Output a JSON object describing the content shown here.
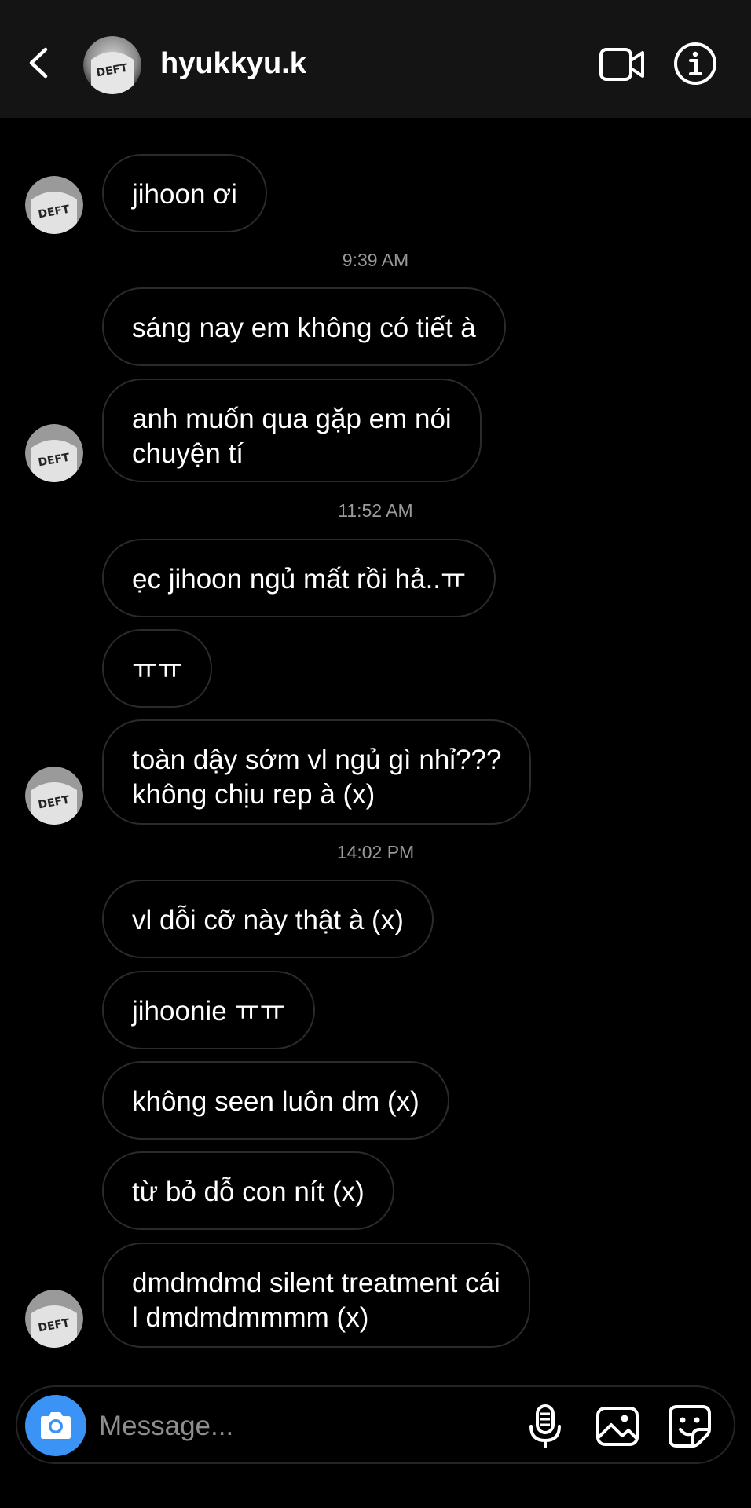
{
  "header": {
    "back_icon": "chevron-left-icon",
    "username": "hyukkyu.k",
    "video_icon": "video-camera-icon",
    "info_icon": "info-icon"
  },
  "avatar": {
    "text": "DEFT"
  },
  "messages": [
    {
      "text": "jihoon ơi"
    },
    {
      "text": "sáng nay em không có tiết à"
    },
    {
      "text": "anh muốn qua gặp em nói\nchuyện tí"
    },
    {
      "text": "ẹc jihoon ngủ mất rồi hả..ㅠ"
    },
    {
      "text": "ㅠㅠ"
    },
    {
      "text": "toàn dậy sớm vl ngủ gì nhỉ???\nkhông chịu rep à (x)"
    },
    {
      "text": "vl dỗi cỡ này thật à (x)"
    },
    {
      "text": "jihoonie ㅠㅠ"
    },
    {
      "text": "không seen luôn dm (x)"
    },
    {
      "text": "từ bỏ dỗ con nít (x)"
    },
    {
      "text": "dmdmdmd silent treatment cái\nl dmdmdmmmm (x)"
    }
  ],
  "timestamps": [
    "9:39 AM",
    "11:52 AM",
    "14:02 PM"
  ],
  "composer": {
    "placeholder": "Message...",
    "camera_icon": "camera-icon",
    "mic_icon": "microphone-icon",
    "gallery_icon": "image-icon",
    "sticker_icon": "sticker-icon",
    "accent": "#3b93f5"
  }
}
